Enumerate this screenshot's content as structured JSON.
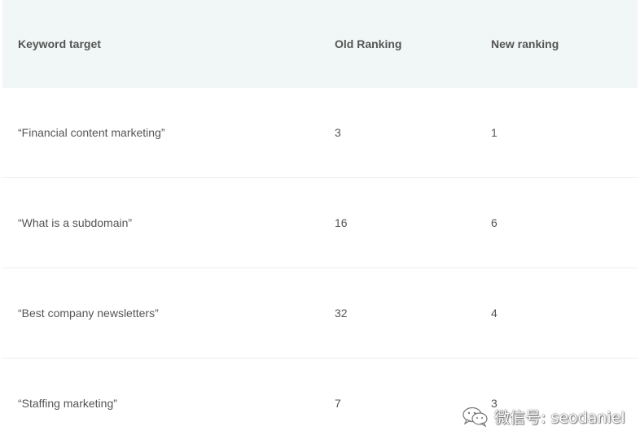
{
  "table": {
    "headers": [
      "Keyword target",
      "Old Ranking",
      "New ranking"
    ],
    "rows": [
      [
        "“Financial content marketing”",
        "3",
        "1"
      ],
      [
        "“What is a subdomain”",
        "16",
        "6"
      ],
      [
        "“Best company newsletters”",
        "32",
        "4"
      ],
      [
        "“Staffing marketing”",
        "7",
        "3"
      ]
    ]
  },
  "watermark": {
    "icon": "wechat-icon",
    "text": "微信号: seodaniel"
  }
}
